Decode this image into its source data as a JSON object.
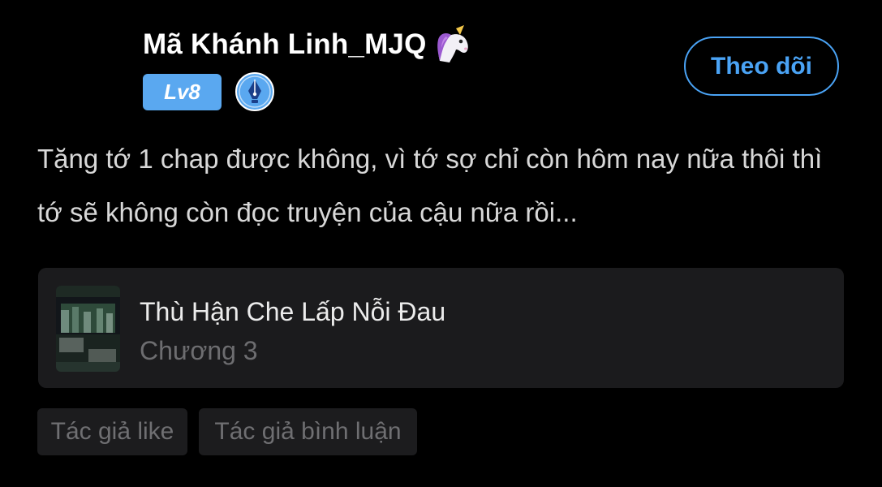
{
  "header": {
    "username": "Mã Khánh Linh_MJQ",
    "level_badge": "Lv8",
    "follow_label": "Theo dõi"
  },
  "comment": {
    "text": "Tặng tớ 1 chap được không, vì tớ sợ chỉ còn hôm nay nữa thôi thì tớ sẽ không còn đọc truyện của cậu nữa rồi..."
  },
  "story_card": {
    "title": "Thù Hận Che Lấp Nỗi Đau",
    "chapter": "Chương 3"
  },
  "tags": {
    "like": "Tác giả like",
    "comment": "Tác giả bình luận"
  },
  "icons": {
    "username_emoji": "unicorn-icon",
    "writer_badge": "pen-badge-icon"
  },
  "colors": {
    "background": "#000000",
    "accent": "#4aa3f5",
    "level_badge": "#5aa8f0",
    "card_background": "#1b1b1d",
    "muted_text": "#6d6d70"
  }
}
